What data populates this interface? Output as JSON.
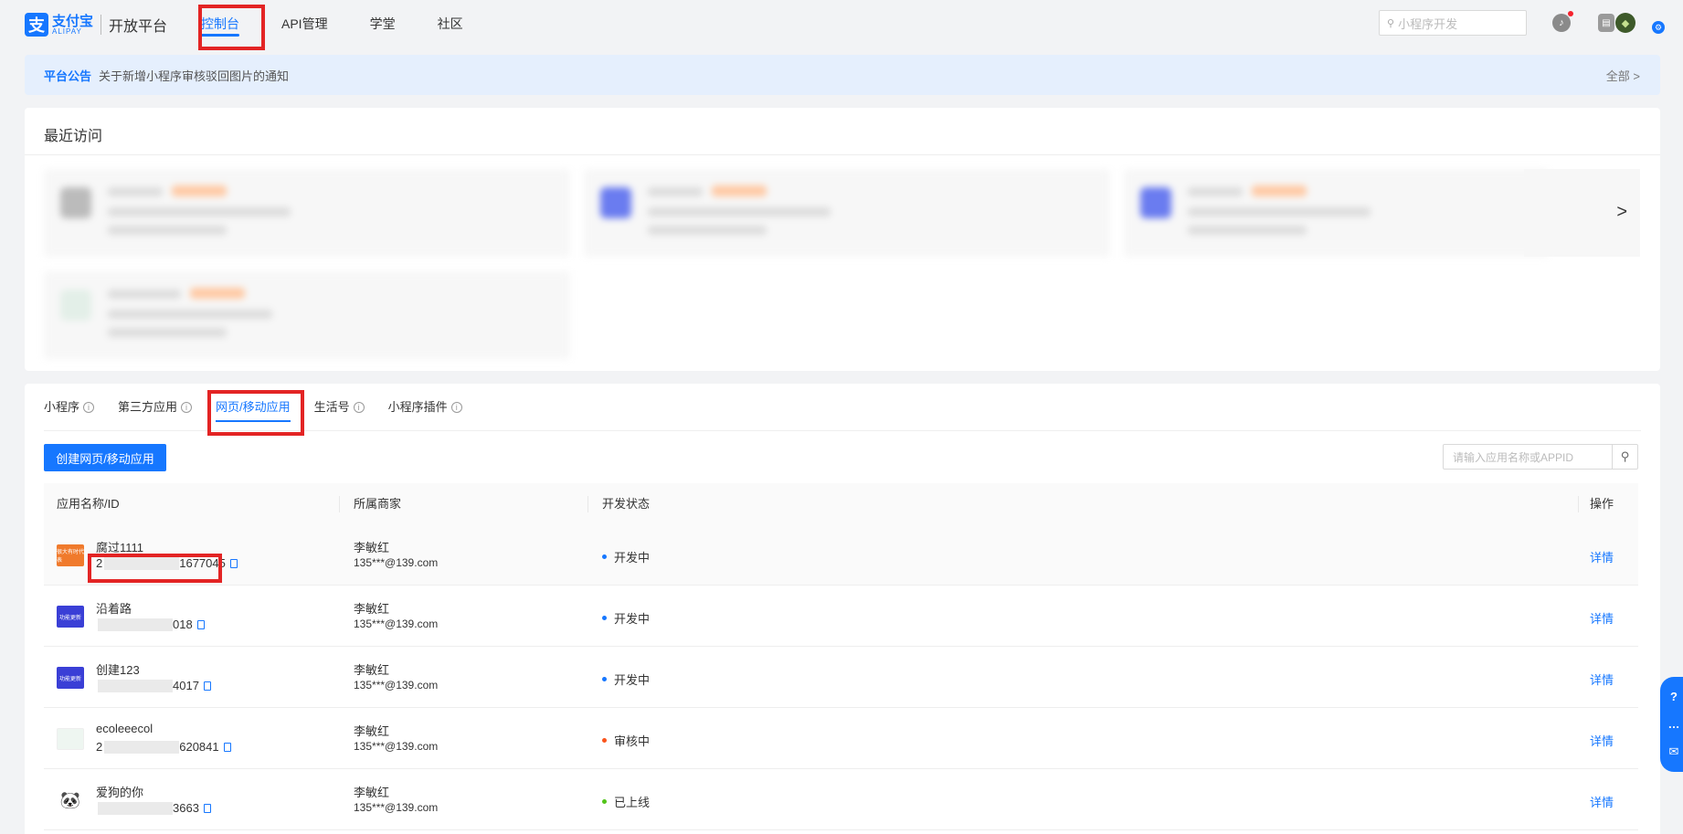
{
  "brand": {
    "logo_glyph": "支",
    "name_cn": "支付宝",
    "name_en": "ALIPAY",
    "platform": "开放平台"
  },
  "nav": [
    {
      "label": "控制台",
      "active": true
    },
    {
      "label": "API管理",
      "active": false
    },
    {
      "label": "学堂",
      "active": false
    },
    {
      "label": "社区",
      "active": false
    }
  ],
  "header": {
    "search_placeholder": "小程序开发",
    "icons": [
      "search-icon",
      "bell-icon",
      "document-icon",
      "avatar",
      "settings-icon"
    ]
  },
  "announcement": {
    "tag": "平台公告",
    "text": "关于新增小程序审核驳回图片的通知",
    "all_link": "全部 >"
  },
  "recent": {
    "title": "最近访问",
    "next_arrow": ">"
  },
  "tabs": [
    {
      "label": "小程序",
      "active": false,
      "info": true
    },
    {
      "label": "第三方应用",
      "active": false,
      "info": true
    },
    {
      "label": "网页/移动应用",
      "active": true,
      "info": false
    },
    {
      "label": "生活号",
      "active": false,
      "info": true
    },
    {
      "label": "小程序插件",
      "active": false,
      "info": true
    }
  ],
  "toolbar": {
    "create_label": "创建网页/移动应用",
    "search_placeholder": "请输入应用名称或APPID"
  },
  "table": {
    "headers": [
      "应用名称/ID",
      "所属商家",
      "开发状态",
      "操作"
    ],
    "rows": [
      {
        "name": "腐过1111",
        "id_prefix": "2",
        "id_suffix": "1677045",
        "merchant": "李敏红",
        "email": "135***@139.com",
        "status": "开发中",
        "status_color": "#1677ff",
        "action": "详情",
        "icon_color": "#f07a2c",
        "icon_text": "很大有时代表"
      },
      {
        "name": "沿着路",
        "id_prefix": "",
        "id_suffix": "018",
        "merchant": "李敏红",
        "email": "135***@139.com",
        "status": "开发中",
        "status_color": "#1677ff",
        "action": "详情",
        "icon_color": "#3a3fd6",
        "icon_text": "功能更新"
      },
      {
        "name": "创建123",
        "id_prefix": "",
        "id_suffix": "4017",
        "merchant": "李敏红",
        "email": "135***@139.com",
        "status": "开发中",
        "status_color": "#1677ff",
        "action": "详情",
        "icon_color": "#3a3fd6",
        "icon_text": "功能更新"
      },
      {
        "name": "ecoleeecol",
        "id_prefix": "2",
        "id_suffix": "620841",
        "merchant": "李敏红",
        "email": "135***@139.com",
        "status": "审核中",
        "status_color": "#fa541c",
        "action": "详情",
        "icon_color": "#e8f5ef",
        "icon_text": ""
      },
      {
        "name": "爱狗的你",
        "id_prefix": "",
        "id_suffix": "3663",
        "merchant": "李敏红",
        "email": "135***@139.com",
        "status": "已上线",
        "status_color": "#52c41a",
        "action": "详情",
        "icon_color": "#ffffff",
        "icon_text": "🐼"
      }
    ]
  },
  "float_bar": [
    "?",
    "…",
    "✉"
  ]
}
